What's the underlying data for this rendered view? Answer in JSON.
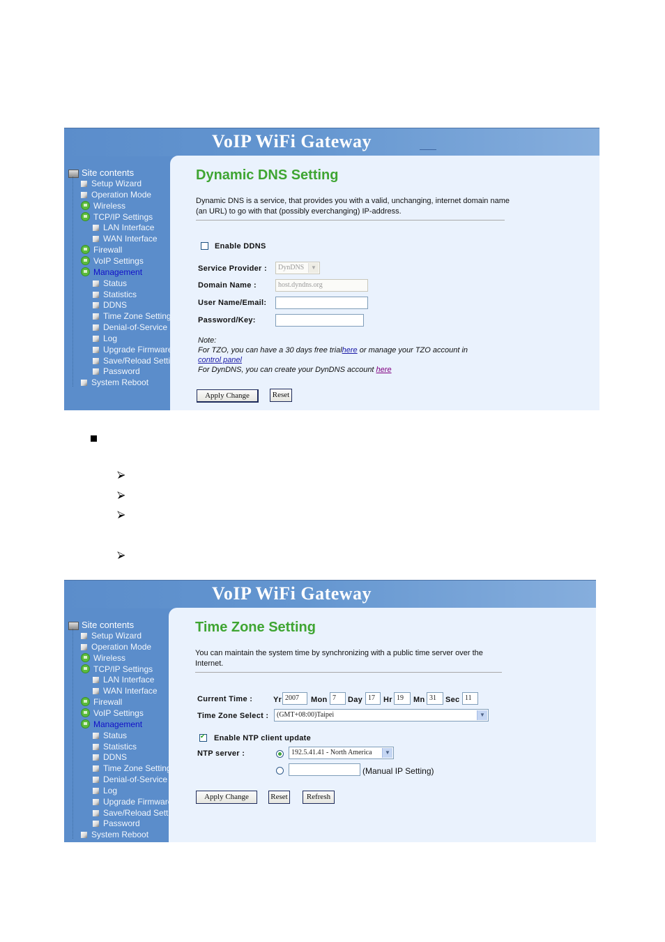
{
  "document": {
    "bullet_icon": "square-bullet-icon",
    "arrow_icon": "arrow-bullet-icon",
    "sub_bullet_count": 4
  },
  "app": {
    "banner_title": "VoIP WiFi Gateway"
  },
  "sidebar": {
    "root_label": "Site contents",
    "items": [
      {
        "label": "Setup Wizard",
        "icon": "page-icon",
        "level": 1
      },
      {
        "label": "Operation Mode",
        "icon": "page-icon",
        "level": 1
      },
      {
        "label": "Wireless",
        "icon": "folder-icon",
        "level": 1
      },
      {
        "label": "TCP/IP Settings",
        "icon": "folder-icon",
        "level": 1
      },
      {
        "label": "LAN Interface",
        "icon": "page-icon",
        "level": 2
      },
      {
        "label": "WAN Interface",
        "icon": "page-icon",
        "level": 2
      },
      {
        "label": "Firewall",
        "icon": "folder-icon",
        "level": 1
      },
      {
        "label": "VoIP Settings",
        "icon": "folder-icon",
        "level": 1
      },
      {
        "label": "Management",
        "icon": "folder-icon",
        "level": 1,
        "active": true
      },
      {
        "label": "Status",
        "icon": "page-icon",
        "level": 2
      },
      {
        "label": "Statistics",
        "icon": "page-icon",
        "level": 2
      },
      {
        "label": "DDNS",
        "icon": "page-icon",
        "level": 2
      },
      {
        "label": "Time Zone Setting",
        "icon": "page-icon",
        "level": 2
      },
      {
        "label": "Denial-of-Service",
        "icon": "page-icon",
        "level": 2
      },
      {
        "label": "Log",
        "icon": "page-icon",
        "level": 2
      },
      {
        "label": "Upgrade Firmware",
        "icon": "page-icon",
        "level": 2
      },
      {
        "label": "Save/Reload Settings",
        "icon": "page-icon",
        "level": 2
      },
      {
        "label": "Password",
        "icon": "page-icon",
        "level": 2
      },
      {
        "label": "System Reboot",
        "icon": "page-icon",
        "level": 1
      }
    ]
  },
  "ddns": {
    "title": "Dynamic DNS  Setting",
    "description": "Dynamic DNS is a service, that provides you with a valid, unchanging, internet domain name (an URL) to go with that (possibly everchanging) IP-address.",
    "enable_label": "Enable DDNS",
    "enable_checked": false,
    "service_provider_label": "Service Provider :",
    "service_provider_value": "DynDNS",
    "domain_name_label": "Domain Name :",
    "domain_name_value": "host.dyndns.org",
    "username_label": "User Name/Email:",
    "username_value": "",
    "password_label": "Password/Key:",
    "password_value": "",
    "note_label": "Note:",
    "note_tzo_prefix": "For TZO, you can have a 30 days free trial",
    "note_tzo_link1": "here",
    "note_tzo_middle": " or manage your TZO account in",
    "note_tzo_link2": "control panel",
    "note_dyndns_prefix": "For DynDNS, you can create your DynDNS account ",
    "note_dyndns_link": "here",
    "apply_label": "Apply Change",
    "reset_label": "Reset"
  },
  "timezone": {
    "title": "Time Zone Setting",
    "description": "You can maintain the system time by synchronizing with a public time server over the Internet.",
    "current_time_label": "Current Time :",
    "yr_label": "Yr",
    "yr_value": "2007",
    "mon_label": "Mon",
    "mon_value": "7",
    "day_label": "Day",
    "day_value": "17",
    "hr_label": "Hr",
    "hr_value": "19",
    "mn_label": "Mn",
    "mn_value": "31",
    "sec_label": "Sec",
    "sec_value": "11",
    "zone_label": "Time Zone Select :",
    "zone_value": "(GMT+08:00)Taipei",
    "ntp_enable_label": "Enable NTP client update",
    "ntp_enable_checked": true,
    "ntp_server_label": "NTP server :",
    "ntp_server_value": "192.5.41.41 - North America",
    "ntp_manual_value": "",
    "ntp_manual_label": "(Manual IP Setting)",
    "apply_label": "Apply Change",
    "reset_label": "Reset",
    "refresh_label": "Refresh"
  },
  "colors": {
    "sidebar_bg": "#5b8dcb",
    "content_bg": "#eaf2fd",
    "title_green": "#3fa532",
    "active_item": "#1010c8"
  }
}
